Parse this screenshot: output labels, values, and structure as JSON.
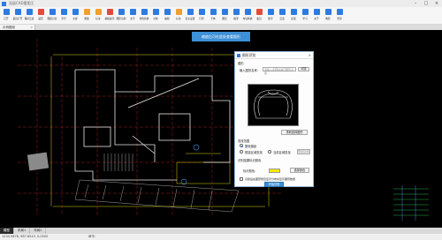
{
  "window": {
    "title": "浩辰CAD看图王"
  },
  "toolbar": {
    "items": [
      {
        "label": "打开",
        "color": "#2d7be0"
      },
      {
        "label": "最近打开",
        "color": "#2d7be0"
      },
      {
        "label": "保存云盘",
        "color": "#2d7be0"
      },
      {
        "label": "返回",
        "color": "#e24a3b"
      },
      {
        "label": "图纸对比",
        "color": "#2d7be0"
      },
      {
        "label": "平行",
        "color": "#2d7be0"
      },
      {
        "label": "全屏",
        "color": "#2d7be0"
      },
      {
        "label": "测量",
        "color": "#f0a030"
      },
      {
        "label": "标注",
        "color": "#f0a030"
      },
      {
        "label": "编辑提示",
        "color": "#e24a3b"
      },
      {
        "label": "图形识别",
        "color": "#2d7be0"
      },
      {
        "label": "文字",
        "color": "#2d7be0"
      },
      {
        "label": "查找替换",
        "color": "#2d7be0"
      },
      {
        "label": "对象",
        "color": "#2d7be0"
      },
      {
        "label": "编辑",
        "color": "#2d7be0"
      },
      {
        "label": "标注",
        "color": "#f0a030"
      },
      {
        "label": "安全设置",
        "color": "#2d7be0"
      },
      {
        "label": "打印",
        "color": "#2d7be0"
      },
      {
        "label": "字体",
        "color": "#2d7be0"
      },
      {
        "label": "图层",
        "color": "#2d7be0"
      },
      {
        "label": "模型",
        "color": "#2d7be0"
      },
      {
        "label": "布局转换",
        "color": "#2d7be0"
      },
      {
        "label": "会员",
        "color": "#e24a3b"
      },
      {
        "label": "账号",
        "color": "#2d7be0"
      },
      {
        "label": "云盘",
        "color": "#2d7be0"
      },
      {
        "label": "反馈",
        "color": "#2d7be0"
      },
      {
        "label": "学习",
        "color": "#2d7be0"
      },
      {
        "label": "关于",
        "color": "#2d7be0"
      },
      {
        "label": "教程",
        "color": "#2d7be0"
      },
      {
        "label": "登录",
        "color": "#2d7be0"
      }
    ]
  },
  "file_tab": {
    "label": "示例图纸"
  },
  "banner": {
    "text": "缩放后可在此处查看图形"
  },
  "dialog": {
    "title": "图形识别",
    "section_label": "图形",
    "name_label": "输入图形名称：",
    "name_placeholder": "请输入名称并进行图形识别",
    "name_button": "浏览",
    "reselect_button": "重新选择图形",
    "range_label": "查找范围",
    "range_option_all": "整张图纸",
    "range_option_window": "框选区域查找",
    "range_option_current": "当前区域查找",
    "range_button": "框选区域",
    "color_section": "识别结果标记颜色",
    "color_label": "标识颜色：",
    "color_button": "选择颜色",
    "checkbox_label": "识别后在图形附近显示分布并显示图形数量",
    "start_button": "开始识别"
  },
  "layout_tabs": [
    "模型",
    "布局1",
    "布局2"
  ],
  "status": {
    "coords": "1234.5678, 987.6543, 0.0000",
    "command": "命令:"
  }
}
